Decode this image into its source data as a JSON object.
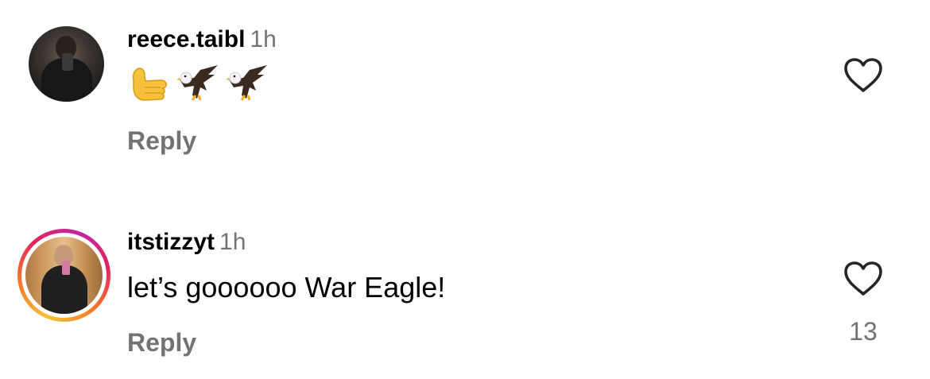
{
  "comments": [
    {
      "username": "reece.taibl",
      "timestamp": "1h",
      "body": "🤙🦅🦅",
      "reply_label": "Reply",
      "like_count": ""
    },
    {
      "username": "itstizzyt",
      "timestamp": "1h",
      "body": "let’s goooooo War Eagle!",
      "reply_label": "Reply",
      "like_count": "13"
    }
  ],
  "icons": {
    "like": "heart-outline-icon",
    "emoji": [
      "call-me-hand-emoji",
      "eagle-emoji",
      "eagle-emoji"
    ]
  },
  "colors": {
    "text": "#000000",
    "secondary": "#737373",
    "story_ring_start": "#f9c13b",
    "story_ring_end": "#c224a5"
  }
}
